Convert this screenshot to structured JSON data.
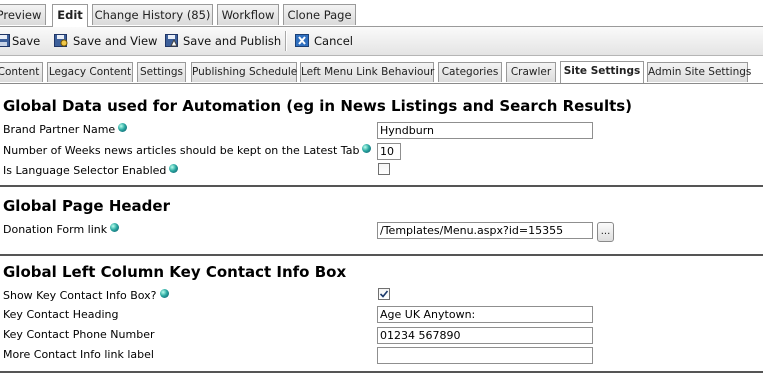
{
  "top_tabs": [
    {
      "label": "Preview"
    },
    {
      "label": "Edit"
    },
    {
      "label": "Change History (85)"
    },
    {
      "label": "Workflow"
    },
    {
      "label": "Clone Page"
    }
  ],
  "toolbar": {
    "save": "Save",
    "save_and_view": "Save and View",
    "save_and_publish": "Save and Publish",
    "cancel": "Cancel"
  },
  "sub_tabs": [
    {
      "label": "Content"
    },
    {
      "label": "Legacy Content"
    },
    {
      "label": "Settings"
    },
    {
      "label": "Publishing Schedule"
    },
    {
      "label": "Left Menu Link Behaviour"
    },
    {
      "label": "Categories"
    },
    {
      "label": "Crawler"
    },
    {
      "label": "Site Settings"
    },
    {
      "label": "Admin Site Settings"
    }
  ],
  "active_sub_tab": "Site Settings",
  "sections": {
    "automation": {
      "title": "Global Data used for Automation (eg in News Listings and Search Results)",
      "brand_partner_label": "Brand Partner Name",
      "brand_partner_value": "Hyndburn",
      "weeks_label": "Number of Weeks news articles should be kept on the Latest Tab",
      "weeks_value": "10",
      "language_label": "Is Language Selector Enabled",
      "language_checked": false
    },
    "header": {
      "title": "Global Page Header",
      "donation_label": "Donation Form link",
      "donation_value": "/Templates/Menu.aspx?id=15355",
      "browse_label": "..."
    },
    "contact": {
      "title": "Global Left Column Key Contact Info Box",
      "show_label": "Show Key Contact Info Box?",
      "show_checked": true,
      "heading_label": "Key Contact Heading",
      "heading_value": "Age UK Anytown:",
      "phone_label": "Key Contact Phone Number",
      "phone_value": "01234 567890",
      "more_label": "More Contact Info link label",
      "more_value": ""
    }
  },
  "colors": {
    "info_dot": "#2aa8a0",
    "divider": "#555555",
    "tab_border": "#9a9a9a"
  }
}
